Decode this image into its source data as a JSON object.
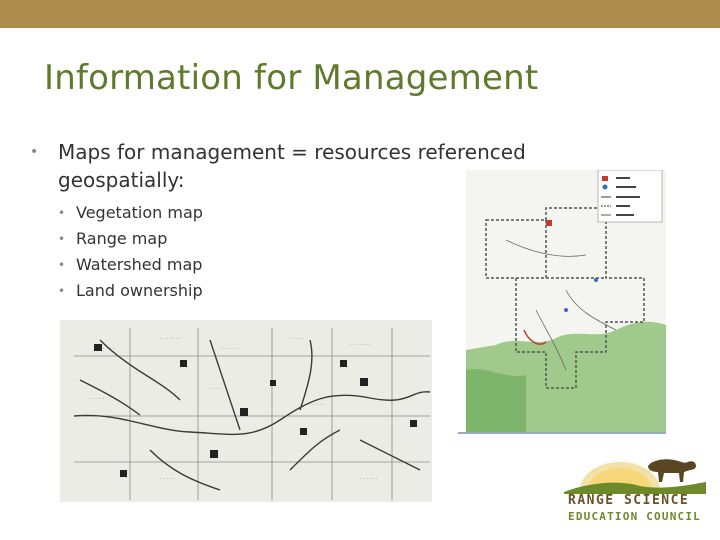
{
  "slide": {
    "title": "Information for Management",
    "bullet": "Maps for management = resources referenced geospatially:",
    "sub_bullets": [
      "Vegetation map",
      "Range map",
      "Watershed map",
      "Land ownership"
    ]
  },
  "logo": {
    "line1": "RANGE SCIENCE",
    "line2": "EDUCATION COUNCIL"
  },
  "colors": {
    "accent_bar": "#ad8c4d",
    "title": "#5f7a2a",
    "logo_brown": "#6a5326",
    "logo_green": "#6d8a2a"
  }
}
